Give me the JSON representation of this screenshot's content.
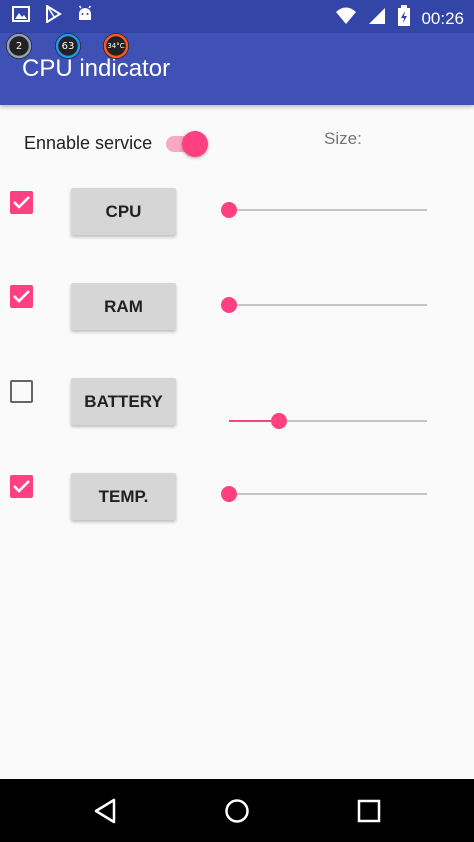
{
  "status_bar": {
    "time": "00:26",
    "left_icons": [
      "image-icon",
      "play-store-icon",
      "android-icon"
    ],
    "right_icons": [
      "wifi-icon",
      "signal-icon",
      "battery-charging-icon"
    ]
  },
  "overlay_gauges": [
    {
      "value": "2",
      "color": "#8ea0b8"
    },
    {
      "value": "63",
      "color": "#2196f3"
    },
    {
      "value": "34°C",
      "color": "#ff5722"
    }
  ],
  "app_bar": {
    "title": "CPU indicator"
  },
  "settings": {
    "enable_label": "Ennable service",
    "enable_on": true,
    "size_label": "Size:"
  },
  "indicators": [
    {
      "label": "CPU",
      "checked": true,
      "size": 0.0
    },
    {
      "label": "RAM",
      "checked": true,
      "size": 0.0
    },
    {
      "label": "BATTERY",
      "checked": false,
      "size": 0.25
    },
    {
      "label": "TEMP.",
      "checked": true,
      "size": 0.0
    }
  ],
  "nav_bar": {
    "icons": [
      "back-icon",
      "home-icon",
      "recents-icon"
    ]
  },
  "colors": {
    "primary": "#3f51b5",
    "primary_dark": "#3445a8",
    "accent": "#ff4081"
  }
}
